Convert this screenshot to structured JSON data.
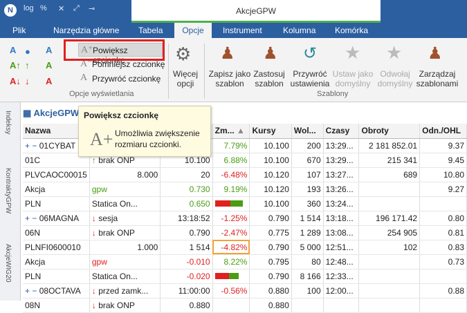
{
  "titlebar": {
    "app_title": "AkcjeGPW",
    "logo": "N",
    "qa_log": "log",
    "qa_percent": "%",
    "qa_icons": [
      "cross-icon",
      "expand-icon",
      "pin-icon"
    ]
  },
  "menu": {
    "items": [
      "Plik",
      "Narzędzia główne",
      "Tabela",
      "Opcje",
      "Instrument",
      "Kolumna",
      "Komórka"
    ],
    "active": "Opcje"
  },
  "ribbon": {
    "increase": "Powiększ czcionkę",
    "decrease": "Pomniejsz czcionkę",
    "restore": "Przywróć czcionkę",
    "group1": "Opcje wyświetlania",
    "more1": "Więcej",
    "more2": "opcji",
    "save1": "Zapisz jako",
    "save2": "szablon",
    "apply1": "Zastosuj",
    "apply2": "szablon",
    "restore_view1": "Przywróć",
    "restore_view2": "ustawienia",
    "default1": "Ustaw jako",
    "default2": "domyślny",
    "undefault1": "Odwołaj",
    "undefault2": "domyślny",
    "manage1": "Zarządzaj",
    "manage2": "szablonami",
    "group2": "Szablony"
  },
  "sidebar": {
    "tabs": [
      "Indeksy",
      "KontraktyGPW",
      "AkcjeWIG20"
    ]
  },
  "window": {
    "title": "AkcjeGPW"
  },
  "tooltip": {
    "title": "Powiększ czcionkę",
    "line1": "Umożliwia zwiększenie",
    "line2": "rozmiaru czcionki.",
    "icon": "A+"
  },
  "table": {
    "headers": [
      "Nazwa",
      "",
      "",
      "Zm...",
      "Kursy",
      "Wol...",
      "Czasy",
      "Obroty",
      "Odn./OHL"
    ],
    "rows": [
      {
        "c0": "01CYBAT",
        "c1": "",
        "c2": "",
        "c3": "7.79%",
        "c4": "10.100",
        "c5": "200",
        "c6": "13:29...",
        "c7": "2 181 852.01",
        "c8": "9.37"
      },
      {
        "c0": "01C",
        "c1": "brak ONP",
        "c2": "10.100",
        "c3": "6.88%",
        "c4": "10.100",
        "c5": "670",
        "c6": "13:29...",
        "c7": "215 341",
        "c8": "9.45"
      },
      {
        "c0": "PLVCAOC00015",
        "c1": "8.000",
        "c2": "20",
        "c3": "-6.48%",
        "c4": "10.120",
        "c5": "107",
        "c6": "13:27...",
        "c7": "689",
        "c8": "10.80"
      },
      {
        "c0": "Akcja",
        "c1": "gpw",
        "c2": "0.730",
        "c3": "9.19%",
        "c4": "10.120",
        "c5": "193",
        "c6": "13:26...",
        "c7": "",
        "c8": "9.27"
      },
      {
        "c0": "PLN",
        "c1": "Statica On...",
        "c2": "0.650",
        "c3": "",
        "c4": "10.100",
        "c5": "360",
        "c6": "13:24...",
        "c7": "",
        "c8": ""
      },
      {
        "c0": "06MAGNA",
        "c1": "sesja",
        "c2": "13:18:52",
        "c3": "-1.25%",
        "c4": "0.790",
        "c5": "1 514",
        "c6": "13:18...",
        "c7": "196 171.42",
        "c8": "0.80"
      },
      {
        "c0": "06N",
        "c1": "brak ONP",
        "c2": "0.790",
        "c3": "-2.47%",
        "c4": "0.775",
        "c5": "1 289",
        "c6": "13:08...",
        "c7": "254 905",
        "c8": "0.81"
      },
      {
        "c0": "PLNFI0600010",
        "c1": "1.000",
        "c2": "1 514",
        "c3": "-4.82%",
        "c4": "0.790",
        "c5": "5 000",
        "c6": "12:51...",
        "c7": "102",
        "c8": "0.83"
      },
      {
        "c0": "Akcja",
        "c1": "gpw",
        "c2": "-0.010",
        "c3": "8.22%",
        "c4": "0.795",
        "c5": "80",
        "c6": "12:48...",
        "c7": "",
        "c8": "0.73"
      },
      {
        "c0": "PLN",
        "c1": "Statica On...",
        "c2": "-0.020",
        "c3": "",
        "c4": "0.790",
        "c5": "8 166",
        "c6": "12:33...",
        "c7": "",
        "c8": ""
      },
      {
        "c0": "08OCTAVA",
        "c1": "przed zamk...",
        "c2": "11:00:00",
        "c3": "-0.56%",
        "c4": "0.880",
        "c5": "100",
        "c6": "12:00...",
        "c7": "",
        "c8": "0.88"
      },
      {
        "c0": "08N",
        "c1": "brak ONP",
        "c2": "0.880",
        "c3": "",
        "c4": "0.880",
        "c5": "",
        "c6": "",
        "c7": "",
        "c8": ""
      }
    ]
  },
  "colors": {
    "brand": "#2c5fa0",
    "positive": "#4a9d12",
    "negative": "#e02020",
    "highlight": "#e02020"
  }
}
